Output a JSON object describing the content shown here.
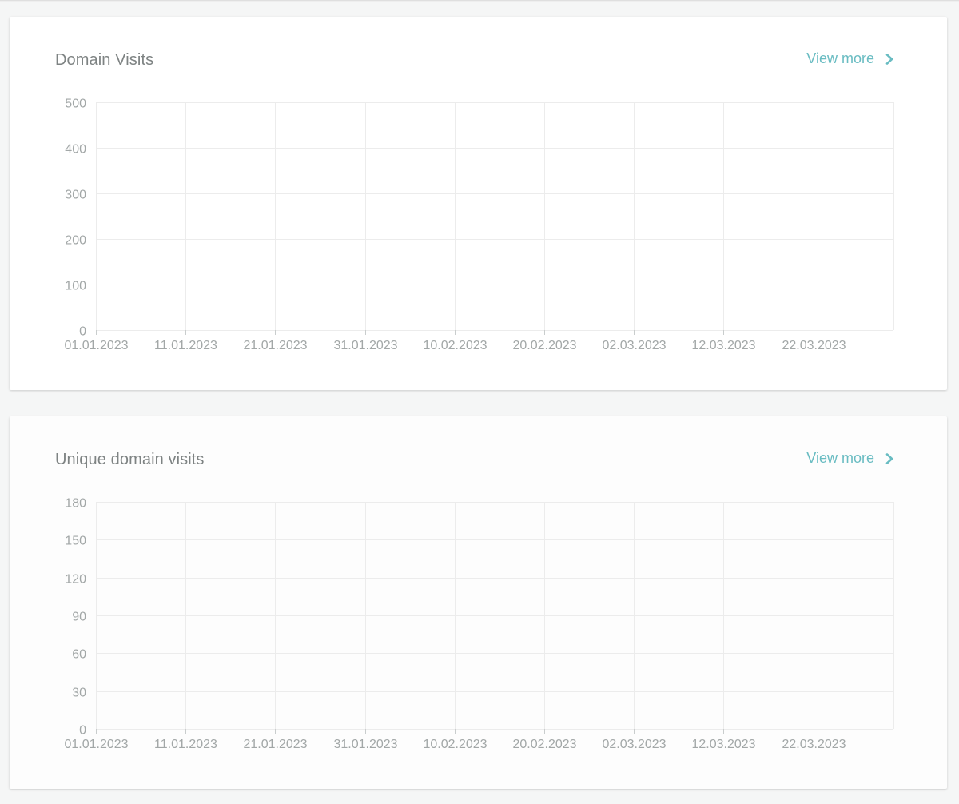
{
  "cards": [
    {
      "title": "Domain Visits",
      "view_more_label": "View more",
      "chevron_icon": "chevron-right-icon"
    },
    {
      "title": "Unique domain visits",
      "view_more_label": "View more",
      "chevron_icon": "chevron-right-icon"
    }
  ],
  "colors": {
    "accent": "#69bcc2",
    "title": "#7e8383",
    "tick_text": "#a2a7a7",
    "grid": "#ececec",
    "page_bg": "#f5f6f6"
  },
  "chart_data": [
    {
      "type": "line",
      "title": "Domain Visits",
      "xlabel": "",
      "ylabel": "",
      "categories": [
        "01.01.2023",
        "11.01.2023",
        "21.01.2023",
        "31.01.2023",
        "10.02.2023",
        "20.02.2023",
        "02.03.2023",
        "12.03.2023",
        "22.03.2023"
      ],
      "y_ticks": [
        0,
        100,
        200,
        300,
        400,
        500
      ],
      "ylim": [
        0,
        500
      ],
      "series": [],
      "grid": true,
      "legend": "none"
    },
    {
      "type": "line",
      "title": "Unique domain visits",
      "xlabel": "",
      "ylabel": "",
      "categories": [
        "01.01.2023",
        "11.01.2023",
        "21.01.2023",
        "31.01.2023",
        "10.02.2023",
        "20.02.2023",
        "02.03.2023",
        "12.03.2023",
        "22.03.2023"
      ],
      "y_ticks": [
        0,
        30,
        60,
        90,
        120,
        150,
        180
      ],
      "ylim": [
        0,
        180
      ],
      "series": [],
      "grid": true,
      "legend": "none"
    }
  ]
}
